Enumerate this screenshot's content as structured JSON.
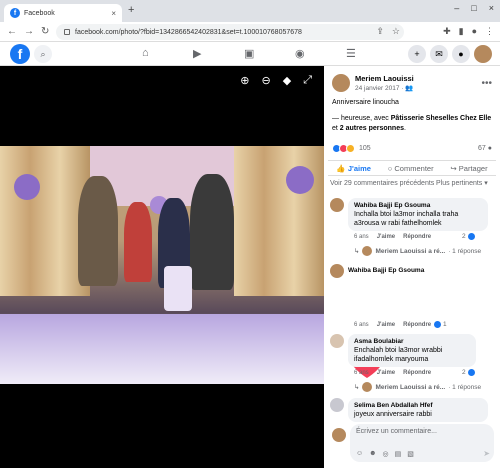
{
  "browser": {
    "tab_title": "Facebook",
    "tab_close": "×",
    "new_tab": "+",
    "url": "facebook.com/photo/?fbid=1342866542402831&set=t.100010768057678",
    "window_controls": [
      "–",
      "□",
      "×"
    ]
  },
  "post": {
    "author": "Meriem Laouissi",
    "date": "24 janvier 2017 · ",
    "title": "Anniversaire linoucha",
    "caption_prefix": "— heureuse, avec ",
    "caption_bold_1": "Pâtisserie Sheselles Chez Elle",
    "caption_mid": " et ",
    "caption_bold_2": "2 autres personnes",
    "caption_end": ".",
    "reactions_count": "105",
    "comments_count": "67",
    "actions": {
      "like": "J'aime",
      "comment": "Commenter",
      "share": "Partager"
    },
    "view_more": "Voir 29 commentaires précédents",
    "sort": "Plus pertinents ▾"
  },
  "comments": [
    {
      "author": "Wahiba Bajji Ep Gsouma",
      "text": "Inchalla btoi la3mor inchalla traha a3rousa w rabi fathelhomlek",
      "time": "6 ans",
      "like": "J'aime",
      "reply": "Répondre",
      "count": "2",
      "reply_author": "Meriem Laouissi a ré...",
      "reply_count": "· 1 réponse"
    },
    {
      "author": "Wahiba Bajji Ep Gsouma",
      "text": "",
      "time": "6 ans",
      "like": "J'aime",
      "reply": "Répondre",
      "count": "1"
    },
    {
      "author": "Asma Boulabiar",
      "text": "Enchalah btoi la3mor wrabbi ifadalhomlek maryouma",
      "time": "6 ans",
      "like": "J'aime",
      "reply": "Répondre",
      "count": "2",
      "reply_author": "Meriem Laouissi a ré...",
      "reply_count": "· 1 réponse"
    },
    {
      "author": "Selima Ben Abdallah Hfef",
      "text": "joyeux anniversaire rabbi"
    }
  ],
  "composer": {
    "placeholder": "Écrivez un commentaire..."
  },
  "colors": {
    "fb_blue": "#1877f2",
    "love_red": "#f33e58"
  }
}
